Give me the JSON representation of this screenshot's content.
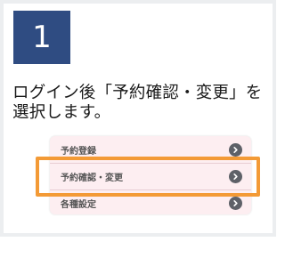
{
  "step": {
    "number": "1"
  },
  "instruction": {
    "text": "ログイン後「予約確認・変更」を\n選択します。"
  },
  "menu": {
    "items": [
      {
        "label": "予約登録",
        "icon": "chevron-right-circle-icon"
      },
      {
        "label": "予約確認・変更",
        "icon": "chevron-right-circle-icon"
      },
      {
        "label": "各種設定",
        "icon": "chevron-right-circle-icon"
      }
    ],
    "highlighted_index": 1
  },
  "colors": {
    "badge": "#2f4c82",
    "highlight": "#f39a36",
    "menu_background": "#fdeef1",
    "chevron_button": "#5e6168"
  }
}
